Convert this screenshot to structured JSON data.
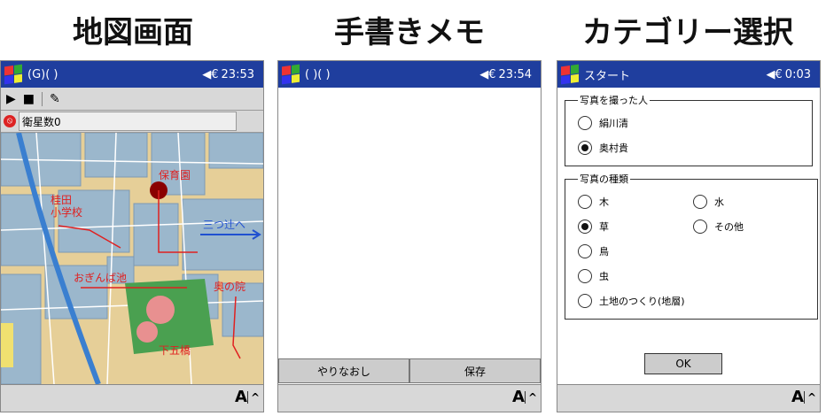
{
  "captions": [
    "地図画面",
    "手書きメモ",
    "カテゴリー選択"
  ],
  "map_panel": {
    "title": "(G)( )",
    "time": "23:53",
    "status_text": "衛星数0",
    "labels": [
      "保育園",
      "桂田",
      "小学校",
      "三つ辻へ",
      "おぎんば池",
      "奥の院",
      "下五橋"
    ]
  },
  "memo_panel": {
    "title": "( )( )",
    "time": "23:54",
    "redo_label": "やりなおし",
    "save_label": "保存"
  },
  "category_panel": {
    "title": "スタート",
    "time": "0:03",
    "photographer_legend": "写真を撮った人",
    "photographers": [
      "絹川清",
      "奥村貴"
    ],
    "photographer_selected": 1,
    "photo_type_legend": "写真の種類",
    "photo_types": [
      "木",
      "水",
      "草",
      "その他",
      "鳥",
      "虫",
      "土地のつくり(地層)"
    ],
    "photo_type_selected": 2,
    "ok_label": "OK"
  },
  "keyboard_label": "A",
  "colors": {
    "titlebar": "#1f3e9e",
    "annotation": "#e02020",
    "link": "#2050d0",
    "park": "#4aa050"
  }
}
